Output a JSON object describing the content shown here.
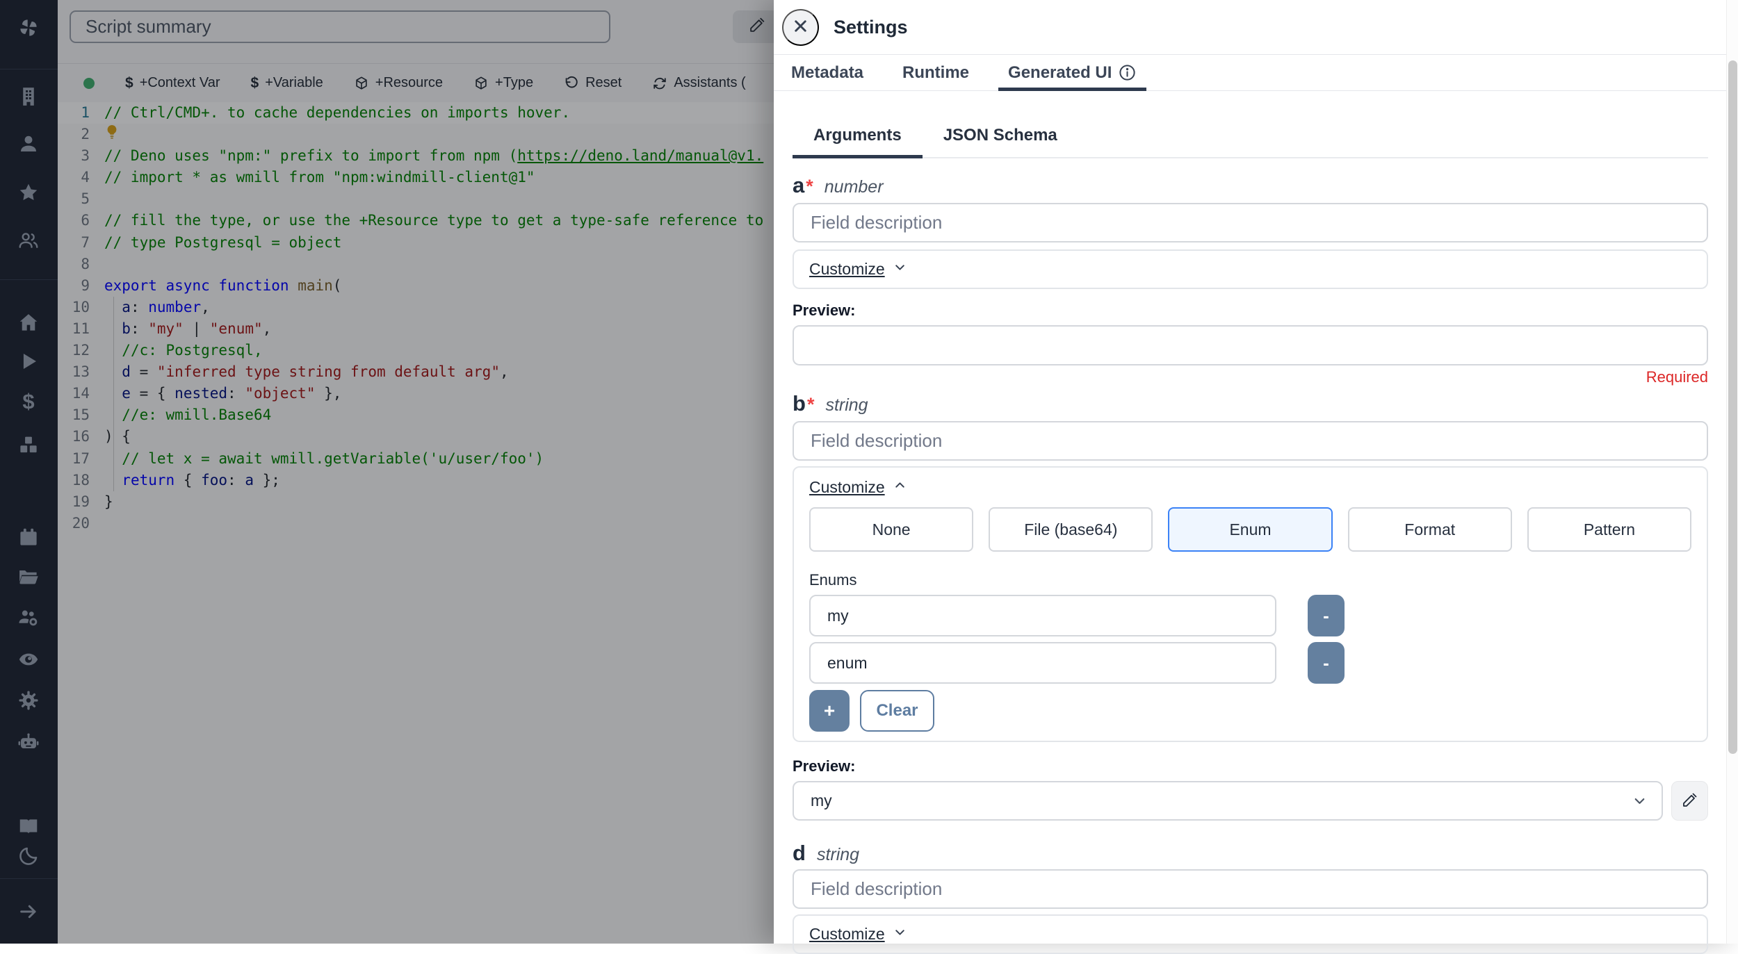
{
  "colors": {
    "accent_blue": "#3b82f6",
    "enum_selected_bg": "#eff6ff",
    "slate_button": "#64809f",
    "required_red": "#dc2626",
    "green_status_dot": "#3fae6d",
    "sidebar_bg": "#1d2432"
  },
  "sidebar": {
    "items": [
      {
        "icon": "windmill-logo"
      },
      {
        "icon": "building-icon"
      },
      {
        "icon": "user-icon"
      },
      {
        "icon": "star-icon"
      },
      {
        "icon": "users-icon"
      },
      {
        "icon": "home-icon"
      },
      {
        "icon": "play-icon"
      },
      {
        "icon": "dollar-icon"
      },
      {
        "icon": "boxes-icon"
      },
      {
        "icon": "calendar-icon"
      },
      {
        "icon": "folder-icon"
      },
      {
        "icon": "user-group-gear-icon"
      },
      {
        "icon": "eye-icon"
      },
      {
        "icon": "gear-icon"
      },
      {
        "icon": "robot-icon"
      },
      {
        "icon": "book-icon"
      },
      {
        "icon": "moon-icon"
      },
      {
        "icon": "arrow-right-icon"
      }
    ]
  },
  "editor": {
    "summary_placeholder": "Script summary",
    "status_dot": "green",
    "toolbar": {
      "items": [
        {
          "icon": "dollar-icon",
          "label": "+Context Var"
        },
        {
          "icon": "dollar-icon",
          "label": "+Variable"
        },
        {
          "icon": "cube-icon",
          "label": "+Resource"
        },
        {
          "icon": "cube-icon",
          "label": "+Type"
        },
        {
          "icon": "reset-icon",
          "label": "Reset"
        },
        {
          "icon": "assistants-icon",
          "label": "Assistants ("
        }
      ]
    },
    "code": {
      "line_count": 20,
      "lines": [
        [
          [
            "c",
            "// Ctrl/CMD+. to cache dependencies on imports hover."
          ]
        ],
        [
          [
            "b",
            ""
          ]
        ],
        [
          [
            "c",
            "// Deno uses \"npm:\" prefix to import from npm ("
          ],
          [
            "u",
            "https://deno.land/manual@v1."
          ]
        ],
        [
          [
            "c",
            "// import * as wmill from \"npm:windmill-client@1\""
          ]
        ],
        [],
        [
          [
            "c",
            "// fill the type, or use the +Resource type to get a type-safe reference to "
          ]
        ],
        [
          [
            "c",
            "// type Postgresql = object"
          ]
        ],
        [],
        [
          [
            "k",
            "export"
          ],
          [
            "p",
            " "
          ],
          [
            "k",
            "async"
          ],
          [
            "p",
            " "
          ],
          [
            "k",
            "function"
          ],
          [
            "p",
            " "
          ],
          [
            "f",
            "main"
          ],
          [
            "p",
            "("
          ]
        ],
        [
          [
            "p",
            "  "
          ],
          [
            "v",
            "a"
          ],
          [
            "p",
            ": "
          ],
          [
            "k",
            "number"
          ],
          [
            "p",
            ","
          ]
        ],
        [
          [
            "p",
            "  "
          ],
          [
            "v",
            "b"
          ],
          [
            "p",
            ": "
          ],
          [
            "s",
            "\"my\""
          ],
          [
            "p",
            " | "
          ],
          [
            "s",
            "\"enum\""
          ],
          [
            "p",
            ","
          ]
        ],
        [
          [
            "p",
            "  "
          ],
          [
            "c",
            "//c: Postgresql,"
          ]
        ],
        [
          [
            "p",
            "  "
          ],
          [
            "v",
            "d"
          ],
          [
            "p",
            " = "
          ],
          [
            "s",
            "\"inferred type string from default arg\""
          ],
          [
            "p",
            ","
          ]
        ],
        [
          [
            "p",
            "  "
          ],
          [
            "v",
            "e"
          ],
          [
            "p",
            " = { "
          ],
          [
            "v",
            "nested"
          ],
          [
            "p",
            ": "
          ],
          [
            "s",
            "\"object\""
          ],
          [
            "p",
            " },"
          ]
        ],
        [
          [
            "p",
            "  "
          ],
          [
            "c",
            "//e: wmill.Base64"
          ]
        ],
        [
          [
            "p",
            ") {"
          ]
        ],
        [
          [
            "p",
            "  "
          ],
          [
            "c",
            "// let x = await wmill.getVariable('u/user/foo')"
          ]
        ],
        [
          [
            "p",
            "  "
          ],
          [
            "k",
            "return"
          ],
          [
            "p",
            " { "
          ],
          [
            "v",
            "foo"
          ],
          [
            "p",
            ": "
          ],
          [
            "v",
            "a"
          ],
          [
            "p",
            " };"
          ]
        ],
        [
          [
            "p",
            "}"
          ]
        ],
        []
      ]
    }
  },
  "settings_panel": {
    "title": "Settings",
    "tabs": [
      {
        "label": "Metadata"
      },
      {
        "label": "Runtime"
      },
      {
        "label": "Generated UI",
        "info": true
      }
    ],
    "active_tab": "Generated UI",
    "subtabs": [
      {
        "label": "Arguments"
      },
      {
        "label": "JSON Schema"
      }
    ],
    "active_subtab": "Arguments",
    "field_placeholder": "Field description",
    "customize_label": "Customize",
    "preview_label": "Preview:",
    "required_mark": "*",
    "args": {
      "a": {
        "name": "a",
        "type": "number",
        "required": true,
        "description": "",
        "preview_value": "",
        "validation": "Required"
      },
      "b": {
        "name": "b",
        "type": "string",
        "required": true,
        "description": "",
        "type_options": [
          "None",
          "File (base64)",
          "Enum",
          "Format",
          "Pattern"
        ],
        "selected_type_option": "Enum",
        "enums_label": "Enums",
        "enum_values": [
          "my",
          "enum"
        ],
        "remove_label": "-",
        "add_label": "+",
        "clear_label": "Clear",
        "preview_value": "my"
      },
      "d": {
        "name": "d",
        "type": "string",
        "required": false,
        "description": ""
      }
    }
  }
}
